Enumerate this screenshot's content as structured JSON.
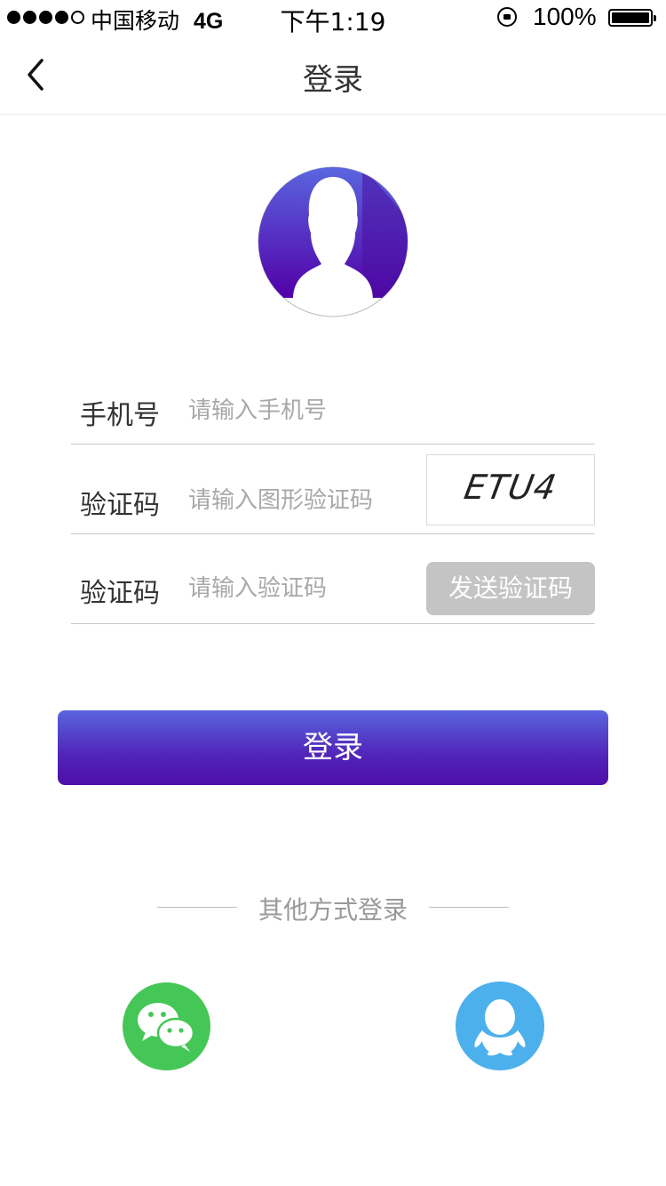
{
  "status_bar": {
    "carrier": "中国移动",
    "network": "4G",
    "time": "下午1:19",
    "battery": "100%"
  },
  "nav": {
    "title": "登录",
    "back_icon": "chevron-left-icon"
  },
  "avatar": {
    "icon": "user-silhouette-icon",
    "colors": {
      "top": "#5a66e0",
      "bottom": "#5200a8"
    }
  },
  "form": {
    "phone": {
      "label": "手机号",
      "placeholder": "请输入手机号",
      "value": ""
    },
    "image_code": {
      "label": "验证码",
      "placeholder": "请输入图形验证码",
      "value": "",
      "captcha_text": "ETU4"
    },
    "sms_code": {
      "label": "验证码",
      "placeholder": "请输入验证码",
      "value": "",
      "send_button": "发送验证码"
    }
  },
  "login_button": {
    "label": "登录",
    "colors": {
      "top": "#5a65e0",
      "bottom": "#4e0fa8"
    }
  },
  "other_login": {
    "title": "其他方式登录",
    "wechat": {
      "icon": "wechat-icon",
      "color": "#45c757"
    },
    "qq": {
      "icon": "qq-icon",
      "color": "#4cb0ec"
    }
  }
}
